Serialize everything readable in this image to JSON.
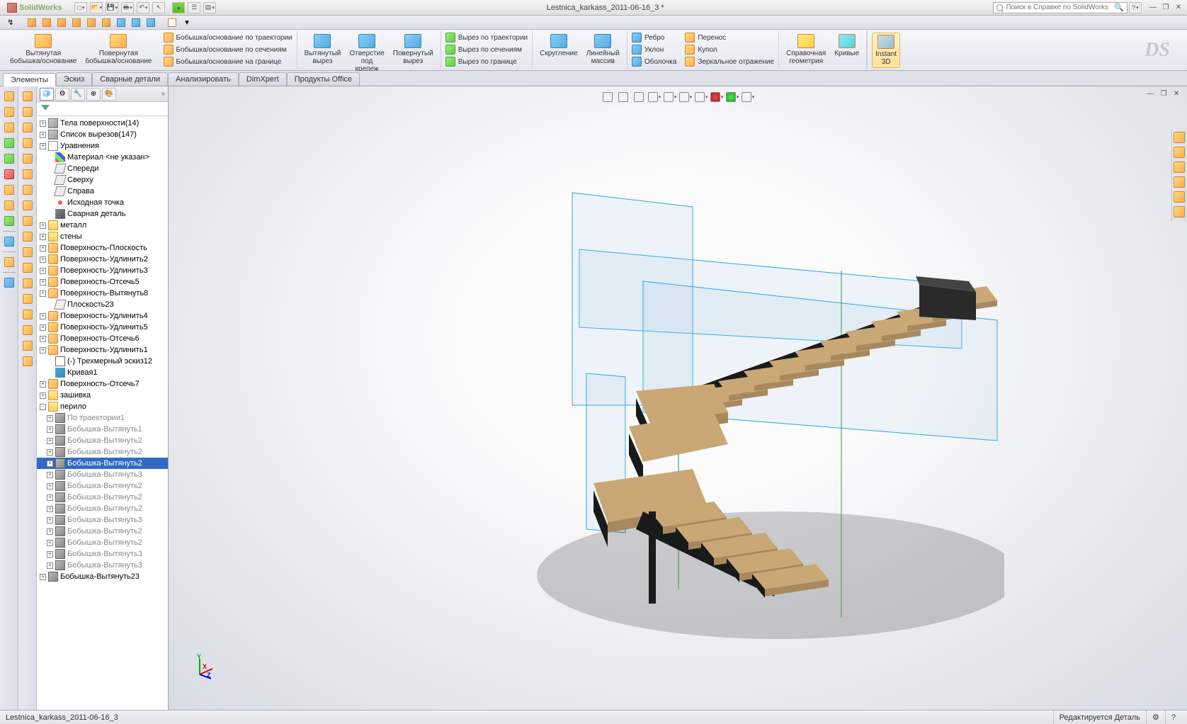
{
  "app_name": "SolidWorks",
  "title": "Lestnica_karkass_2011-06-16_3 *",
  "search_placeholder": "Поиск в Справке по SolidWorks",
  "ribbon": {
    "group1": [
      {
        "label": "Вытянутая\nбобышка/основание"
      },
      {
        "label": "Повернутая\nбобышка/основание"
      }
    ],
    "group1b": [
      {
        "label": "Бобышка/основание по траектории"
      },
      {
        "label": "Бобышка/основание по сечениям"
      },
      {
        "label": "Бобышка/основание на границе"
      }
    ],
    "group2": [
      {
        "label": "Вытянутый\nвырез"
      },
      {
        "label": "Отверстие\nпод\nкрепеж"
      },
      {
        "label": "Повернутый\nвырез"
      }
    ],
    "group2b": [
      {
        "label": "Вырез по траектории"
      },
      {
        "label": "Вырез по сечениям"
      },
      {
        "label": "Вырез по границе"
      }
    ],
    "group3": [
      {
        "label": "Скругление"
      },
      {
        "label": "Линейный\nмассив"
      }
    ],
    "group3b": [
      {
        "label": "Ребро"
      },
      {
        "label": "Уклон"
      },
      {
        "label": "Оболочка"
      }
    ],
    "group3c": [
      {
        "label": "Перенос"
      },
      {
        "label": "Купол"
      },
      {
        "label": "Зеркальное отражение"
      }
    ],
    "group4": [
      {
        "label": "Справочная\nгеометрия"
      },
      {
        "label": "Кривые"
      }
    ],
    "instant3d": "Instant\n3D"
  },
  "tabs": [
    "Элементы",
    "Эскиз",
    "Сварные детали",
    "Анализировать",
    "DimXpert",
    "Продукты Office"
  ],
  "tree": [
    {
      "exp": "+",
      "ico": "body",
      "lbl": "Тела поверхности(14)",
      "ind": 0
    },
    {
      "exp": "+",
      "ico": "body",
      "lbl": "Список вырезов(147)",
      "ind": 0
    },
    {
      "exp": "+",
      "ico": "eq",
      "lbl": "Уравнения",
      "ind": 0
    },
    {
      "exp": " ",
      "ico": "mat",
      "lbl": "Материал <не указан>",
      "ind": 1
    },
    {
      "exp": " ",
      "ico": "plane",
      "lbl": "Спереди",
      "ind": 1
    },
    {
      "exp": " ",
      "ico": "plane",
      "lbl": "Сверху",
      "ind": 1
    },
    {
      "exp": " ",
      "ico": "plane",
      "lbl": "Справа",
      "ind": 1
    },
    {
      "exp": " ",
      "ico": "origin",
      "lbl": "Исходная точка",
      "ind": 1
    },
    {
      "exp": " ",
      "ico": "weld",
      "lbl": "Сварная деталь",
      "ind": 1
    },
    {
      "exp": "+",
      "ico": "folder",
      "lbl": "металл",
      "ind": 0
    },
    {
      "exp": "+",
      "ico": "folder",
      "lbl": "стены",
      "ind": 0
    },
    {
      "exp": "+",
      "ico": "surf",
      "lbl": "Поверхность-Плоскость",
      "ind": 0
    },
    {
      "exp": "+",
      "ico": "surf",
      "lbl": "Поверхность-Удлинить2",
      "ind": 0
    },
    {
      "exp": "+",
      "ico": "surf",
      "lbl": "Поверхность-Удлинить3",
      "ind": 0
    },
    {
      "exp": "+",
      "ico": "surf",
      "lbl": "Поверхность-Отсечь5",
      "ind": 0
    },
    {
      "exp": "+",
      "ico": "surf",
      "lbl": "Поверхность-Вытянуть8",
      "ind": 0
    },
    {
      "exp": " ",
      "ico": "plane",
      "lbl": "Плоскость23",
      "ind": 1
    },
    {
      "exp": "+",
      "ico": "surf",
      "lbl": "Поверхность-Удлинить4",
      "ind": 0
    },
    {
      "exp": "+",
      "ico": "surf",
      "lbl": "Поверхность-Удлинить5",
      "ind": 0
    },
    {
      "exp": "+",
      "ico": "surf",
      "lbl": "Поверхность-Отсечь6",
      "ind": 0
    },
    {
      "exp": "+",
      "ico": "surf",
      "lbl": "Поверхность-Удлинить1",
      "ind": 0
    },
    {
      "exp": " ",
      "ico": "sketch",
      "lbl": "(-) Трехмерный эскиз12",
      "ind": 1
    },
    {
      "exp": " ",
      "ico": "curve",
      "lbl": "Кривая1",
      "ind": 1
    },
    {
      "exp": "+",
      "ico": "surf",
      "lbl": "Поверхность-Отсечь7",
      "ind": 0
    },
    {
      "exp": "+",
      "ico": "folder",
      "lbl": "зашивка",
      "ind": 0
    },
    {
      "exp": "-",
      "ico": "folder",
      "lbl": "перило",
      "ind": 0
    },
    {
      "exp": "+",
      "ico": "boss",
      "lbl": "По траектории1",
      "ind": 1,
      "dim": true
    },
    {
      "exp": "+",
      "ico": "boss",
      "lbl": "Бобышка-Вытянуть1",
      "ind": 1,
      "dim": true
    },
    {
      "exp": "+",
      "ico": "boss",
      "lbl": "Бобышка-Вытянуть2",
      "ind": 1,
      "dim": true
    },
    {
      "exp": "+",
      "ico": "boss",
      "lbl": "Бобышка-Вытянуть2",
      "ind": 1,
      "dim": true
    },
    {
      "exp": "+",
      "ico": "boss",
      "lbl": "Бобышка-Вытянуть2",
      "ind": 1,
      "sel": true
    },
    {
      "exp": "+",
      "ico": "boss",
      "lbl": "Бобышка-Вытянуть3",
      "ind": 1,
      "dim": true
    },
    {
      "exp": "+",
      "ico": "boss",
      "lbl": "Бобышка-Вытянуть2",
      "ind": 1,
      "dim": true
    },
    {
      "exp": "+",
      "ico": "boss",
      "lbl": "Бобышка-Вытянуть2",
      "ind": 1,
      "dim": true
    },
    {
      "exp": "+",
      "ico": "boss",
      "lbl": "Бобышка-Вытянуть2",
      "ind": 1,
      "dim": true
    },
    {
      "exp": "+",
      "ico": "boss",
      "lbl": "Бобышка-Вытянуть3",
      "ind": 1,
      "dim": true
    },
    {
      "exp": "+",
      "ico": "boss",
      "lbl": "Бобышка-Вытянуть2",
      "ind": 1,
      "dim": true
    },
    {
      "exp": "+",
      "ico": "boss",
      "lbl": "Бобышка-Вытянуть2",
      "ind": 1,
      "dim": true
    },
    {
      "exp": "+",
      "ico": "boss",
      "lbl": "Бобышка-Вытянуть3",
      "ind": 1,
      "dim": true
    },
    {
      "exp": "+",
      "ico": "boss",
      "lbl": "Бобышка-Вытянуть3",
      "ind": 1,
      "dim": true
    },
    {
      "exp": "+",
      "ico": "boss",
      "lbl": "Бобышка-Вытянуть23",
      "ind": 0
    }
  ],
  "status_left": "Lestnica_karkass_2011-06-16_3",
  "status_right": "Редактируется Деталь",
  "triad": {
    "x": "X",
    "y": "Y",
    "z": "Z"
  }
}
